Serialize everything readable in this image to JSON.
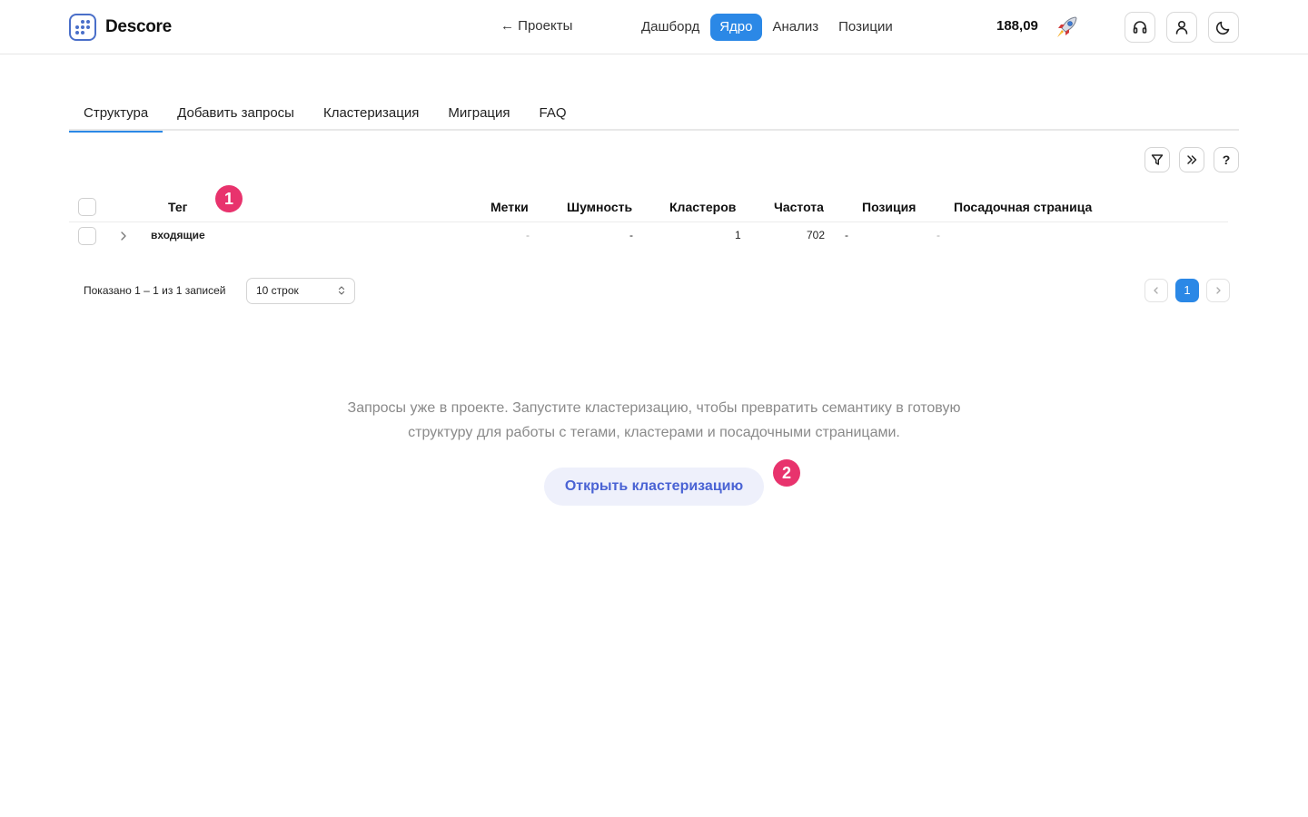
{
  "app": {
    "name": "Descore"
  },
  "header": {
    "back_label": "← Проекты",
    "nav": [
      {
        "label": "Дашборд",
        "active": false
      },
      {
        "label": "Ядро",
        "active": true
      },
      {
        "label": "Анализ",
        "active": false
      },
      {
        "label": "Позиции",
        "active": false
      }
    ],
    "balance": "188,09",
    "icons": [
      "headset-icon",
      "user-icon",
      "moon-icon"
    ],
    "accent_color": "#2b88e6"
  },
  "tabs": [
    {
      "label": "Структура",
      "active": true
    },
    {
      "label": "Добавить запросы",
      "active": false
    },
    {
      "label": "Кластеризация",
      "active": false
    },
    {
      "label": "Миграция",
      "active": false
    },
    {
      "label": "FAQ",
      "active": false
    }
  ],
  "toolbar": {
    "icons": [
      "filter-icon",
      "chevrons-right-icon",
      "help-icon"
    ],
    "help_label": "?"
  },
  "table": {
    "columns": [
      "Тег",
      "Метки",
      "Шумность",
      "Кластеров",
      "Частота",
      "Позиция",
      "Посадочная страница"
    ],
    "rows": [
      {
        "tag": "входящие",
        "labels": "-",
        "noise": "-",
        "clusters": "1",
        "frequency": "702",
        "position": "-",
        "landing": "-"
      }
    ]
  },
  "annotations": {
    "badge1": "1",
    "badge2": "2",
    "color": "#e8336d"
  },
  "pagination": {
    "shown_text": "Показано 1 – 1 из 1 записей",
    "rows_per_page": "10 строк",
    "current_page": "1"
  },
  "empty_state": {
    "line1": "Запросы уже в проекте. Запустите кластеризацию, чтобы превратить семантику в готовую",
    "line2": "структуру для работы с тегами, кластерами и посадочными страницами.",
    "button_label": "Открыть кластеризацию"
  }
}
